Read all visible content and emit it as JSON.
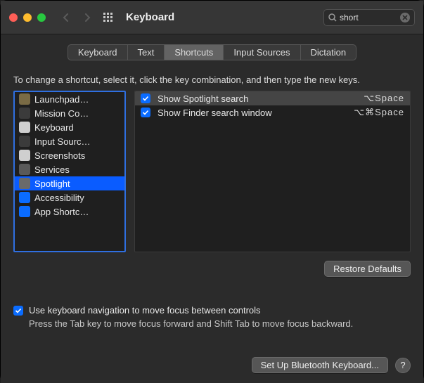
{
  "title": "Keyboard",
  "search": {
    "value": "short"
  },
  "tabs": [
    "Keyboard",
    "Text",
    "Shortcuts",
    "Input Sources",
    "Dictation"
  ],
  "activeTab": 2,
  "instructions": "To change a shortcut, select it, click the key combination, and then type the new keys.",
  "categories": [
    {
      "label": "Launchpad…",
      "iconBg": "#7a6b45"
    },
    {
      "label": "Mission Co…",
      "iconBg": "#3b3b3b"
    },
    {
      "label": "Keyboard",
      "iconBg": "#cfcfcf"
    },
    {
      "label": "Input Sourc…",
      "iconBg": "#3b3b3b"
    },
    {
      "label": "Screenshots",
      "iconBg": "#cfcfcf"
    },
    {
      "label": "Services",
      "iconBg": "#5a5a5a"
    },
    {
      "label": "Spotlight",
      "iconBg": "#6a6a6a",
      "selected": true
    },
    {
      "label": "Accessibility",
      "iconBg": "#0a6cff"
    },
    {
      "label": "App Shortc…",
      "iconBg": "#0a6cff"
    }
  ],
  "shortcuts": [
    {
      "checked": true,
      "label": "Show Spotlight search",
      "keys": "⌥Space",
      "selected": true
    },
    {
      "checked": true,
      "label": "Show Finder search window",
      "keys": "⌥⌘Space"
    }
  ],
  "restore": "Restore Defaults",
  "kbnav": {
    "checked": true,
    "label": "Use keyboard navigation to move focus between controls",
    "sub": "Press the Tab key to move focus forward and Shift Tab to move focus backward."
  },
  "bluetooth": "Set Up Bluetooth Keyboard...",
  "help": "?"
}
